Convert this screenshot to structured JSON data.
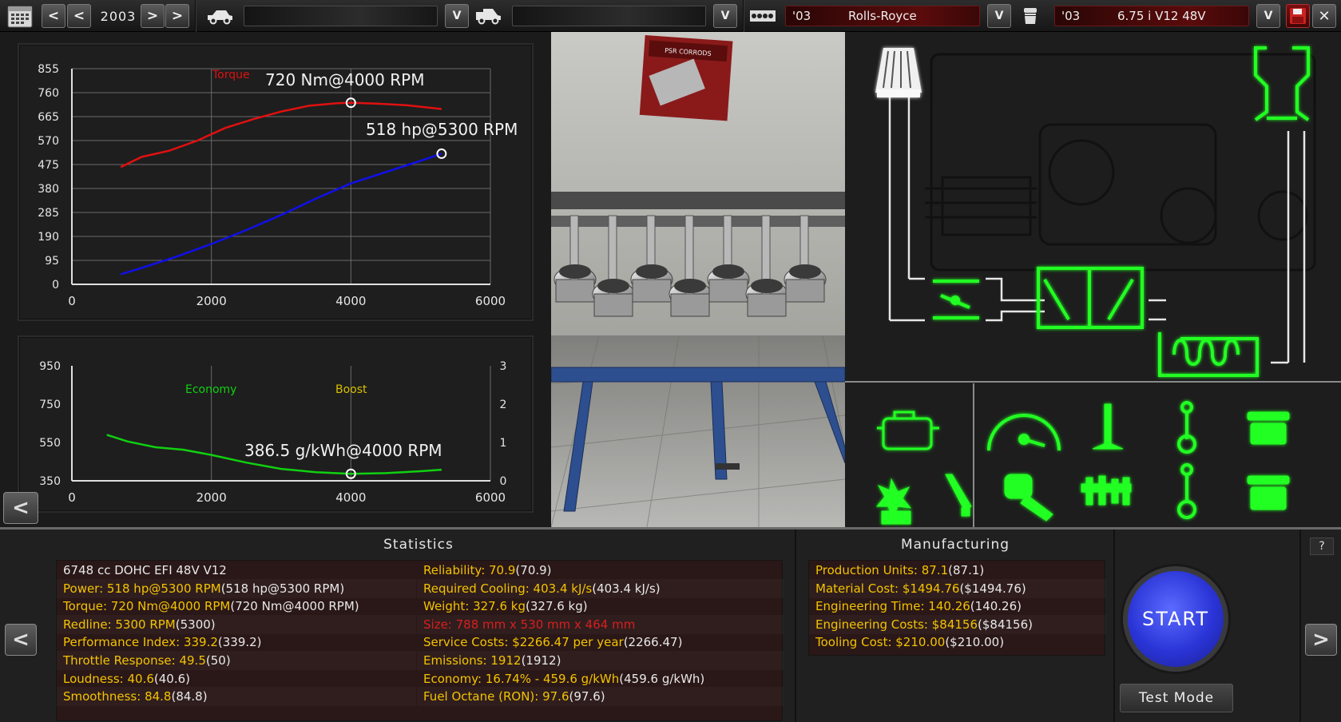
{
  "topbar": {
    "calendar_icon": "calendar-icon",
    "year": "2003",
    "prev_button": "<",
    "next_button": ">",
    "dropdown_button": "V",
    "family_prefix": "'03",
    "family_name": "Rolls-Royce",
    "variant_prefix": "'03",
    "variant_name": "6.75 i V12 48V",
    "save_icon": "floppy-disk-icon",
    "close_icon": "close-icon"
  },
  "power_chart": {
    "torque_legend": "Torque",
    "torque_annotation": "720 Nm@4000 RPM",
    "power_annotation": "518 hp@5300 RPM"
  },
  "economy_chart": {
    "economy_legend": "Economy",
    "boost_legend": "Boost",
    "economy_annotation": "386.5 g/kWh@4000 RPM"
  },
  "chart_data": [
    {
      "type": "line",
      "xlim": [
        0,
        6000
      ],
      "ylim": [
        0,
        855
      ],
      "x_ticks": [
        "0",
        "2000",
        "4000",
        "6000"
      ],
      "y_ticks": [
        "855",
        "760",
        "665",
        "570",
        "475",
        "380",
        "285",
        "190",
        "95",
        "0"
      ],
      "series": [
        {
          "name": "Torque",
          "color": "#e01010",
          "x": [
            700,
            1000,
            1400,
            1800,
            2200,
            2600,
            3000,
            3400,
            3800,
            4000,
            4400,
            4800,
            5300
          ],
          "y": [
            465,
            505,
            530,
            570,
            620,
            655,
            685,
            708,
            718,
            720,
            716,
            710,
            695
          ]
        },
        {
          "name": "Power",
          "color": "#1010e8",
          "x": [
            700,
            1000,
            1500,
            2000,
            2500,
            3000,
            3500,
            4000,
            4500,
            5000,
            5300
          ],
          "y": [
            40,
            65,
            110,
            160,
            215,
            275,
            340,
            400,
            445,
            490,
            518
          ]
        }
      ],
      "markers": [
        {
          "x": 4000,
          "y": 720,
          "label": "720 Nm@4000 RPM"
        },
        {
          "x": 5300,
          "y": 518,
          "label": "518 hp@5300 RPM"
        }
      ]
    },
    {
      "type": "line",
      "xlim": [
        0,
        6000
      ],
      "ylim": [
        350,
        950
      ],
      "y2lim": [
        0,
        3
      ],
      "x_ticks": [
        "0",
        "2000",
        "4000",
        "6000"
      ],
      "y_ticks": [
        "950",
        "750",
        "550",
        "350"
      ],
      "y2_ticks": [
        "3",
        "2",
        "1",
        "0"
      ],
      "series": [
        {
          "name": "Economy",
          "color": "#10d010",
          "x": [
            500,
            800,
            1200,
            1600,
            2000,
            2500,
            3000,
            3500,
            4000,
            4500,
            5000,
            5300
          ],
          "y": [
            590,
            555,
            525,
            512,
            485,
            445,
            412,
            395,
            386.5,
            390,
            400,
            408
          ]
        }
      ],
      "markers": [
        {
          "x": 4000,
          "y": 386.5,
          "label": "386.5 g/kWh@4000 RPM"
        }
      ]
    }
  ],
  "viewport": {
    "poster_title": "PSR CORRODS"
  },
  "diagram": {
    "components": [
      "air-filter-icon",
      "intake-manifold-icon",
      "throttle-body-icon",
      "exhaust-manifold-icon",
      "headers-icon",
      "muffler-icon"
    ]
  },
  "parts_grid": [
    "engine-block-icon",
    "gauge-icon",
    "valve-icon",
    "conrod-icon",
    "piston-icon",
    "ignition-icon",
    "spark-plug-icon",
    "wrench-fist-icon",
    "camshaft-icon",
    "conrod-2-icon",
    "piston-2-icon"
  ],
  "statistics": {
    "header": "Statistics",
    "left": [
      {
        "label": "6748 cc DOHC EFI 48V V12",
        "base": "",
        "style": "w"
      },
      {
        "label": "Power: 518 hp@5300 RPM",
        "base": " (518 hp@5300 RPM)",
        "style": "y"
      },
      {
        "label": "Torque: 720 Nm@4000 RPM",
        "base": " (720 Nm@4000 RPM)",
        "style": "y"
      },
      {
        "label": "Redline: 5300 RPM",
        "base": " (5300)",
        "style": "y"
      },
      {
        "label": "Performance Index: 339.2",
        "base": " (339.2)",
        "style": "y"
      },
      {
        "label": "Throttle Response: 49.5",
        "base": " (50)",
        "style": "y"
      },
      {
        "label": "Loudness: 40.6",
        "base": " (40.6)",
        "style": "y"
      },
      {
        "label": "Smoothness: 84.8",
        "base": " (84.8)",
        "style": "y"
      }
    ],
    "right": [
      {
        "label": "Reliability: 70.9",
        "base": " (70.9)",
        "style": "y"
      },
      {
        "label": "Required Cooling: 403.4 kJ/s",
        "base": " (403.4 kJ/s)",
        "style": "y"
      },
      {
        "label": "Weight: 327.6 kg",
        "base": " (327.6 kg)",
        "style": "y"
      },
      {
        "label": "Size: 788 mm x 530 mm x 464 mm",
        "base": "",
        "style": "r"
      },
      {
        "label": "Service Costs: $2266.47 per year",
        "base": " (2266.47)",
        "style": "y"
      },
      {
        "label": "Emissions: 1912",
        "base": " (1912)",
        "style": "y"
      },
      {
        "label": "Economy: 16.74% - 459.6 g/kWh",
        "base": " (459.6 g/kWh)",
        "style": "y"
      },
      {
        "label": "Fuel Octane (RON): 97.6",
        "base": " (97.6)",
        "style": "y"
      }
    ]
  },
  "manufacturing": {
    "header": "Manufacturing",
    "rows": [
      {
        "label": "Production Units: 87.1",
        "base": " (87.1)"
      },
      {
        "label": "Material Cost: $1494.76",
        "base": " ($1494.76)"
      },
      {
        "label": "Engineering Time: 140.26",
        "base": " (140.26)"
      },
      {
        "label": "Engineering Costs: $84156",
        "base": " ($84156)"
      },
      {
        "label": "Tooling Cost: $210.00",
        "base": " ($210.00)"
      }
    ]
  },
  "controls": {
    "start_label": "START",
    "test_mode_label": "Test Mode",
    "help_label": "?",
    "back_label": "<",
    "forward_label": ">",
    "collapse_label": "<"
  },
  "colors": {
    "torque": "#e01010",
    "power": "#1010e8",
    "economy": "#10d010",
    "boost": "#d8c000",
    "highlight": "#f3c300",
    "warning": "#d81e1e",
    "diagram_green": "#22ff22"
  }
}
